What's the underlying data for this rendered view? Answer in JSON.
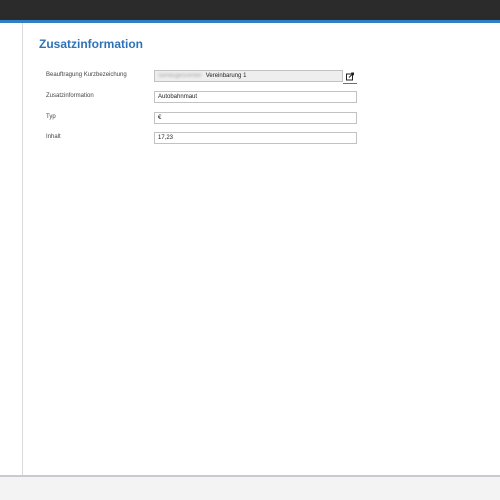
{
  "page": {
    "title": "Zusatzinformation"
  },
  "form": {
    "auftrag": {
      "label": "Beauftragung Kurzbezeichung",
      "value_blurred": "Sendugescenter",
      "value": "Vereinbarung 1"
    },
    "zusatzinformation": {
      "label": "Zusatzinformation",
      "value": "Autobahnmaut"
    },
    "typ": {
      "label": "Typ",
      "value": "€"
    },
    "inhalt": {
      "label": "Inhalt",
      "value": "17,23"
    }
  },
  "icons": {
    "edit": "external-edit-icon"
  },
  "colors": {
    "accent": "#2f7fc6",
    "title": "#2f73b6",
    "topbar": "#2b2b2b"
  }
}
